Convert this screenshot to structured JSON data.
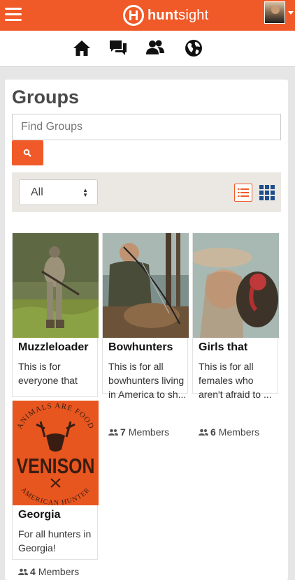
{
  "app": {
    "brand_prefix": "hunt",
    "brand_suffix": "sight",
    "accent_color": "#f05a28"
  },
  "nav": {
    "icons": [
      "home-icon",
      "messages-icon",
      "friends-icon",
      "globe-icon"
    ]
  },
  "page": {
    "title": "Groups",
    "search_placeholder": "Find Groups",
    "search_icon": "search-icon",
    "filter_value": "All",
    "view_modes": [
      "list-view-icon",
      "grid-view-icon"
    ],
    "active_view": "grid"
  },
  "groups": [
    {
      "name": "Muzzleloader",
      "description": "This is for everyone that hunts deer with",
      "members_count": "",
      "members_label": ""
    },
    {
      "name": "Bowhunters",
      "description": "This is for all bowhunters living in America to sh...",
      "members_count": "7",
      "members_label": "Members"
    },
    {
      "name": "Girls that",
      "description": "This is for all females who aren't afraid to ...",
      "members_count": "6",
      "members_label": "Members"
    },
    {
      "name": "Georgia",
      "description": "For all hunters in Georgia!",
      "members_count": "4",
      "members_label": "Members",
      "image_text": {
        "top": "ANIMALS ARE FOOD",
        "main": "VENISON",
        "bottom": "AMERICAN HUNTER"
      }
    }
  ]
}
